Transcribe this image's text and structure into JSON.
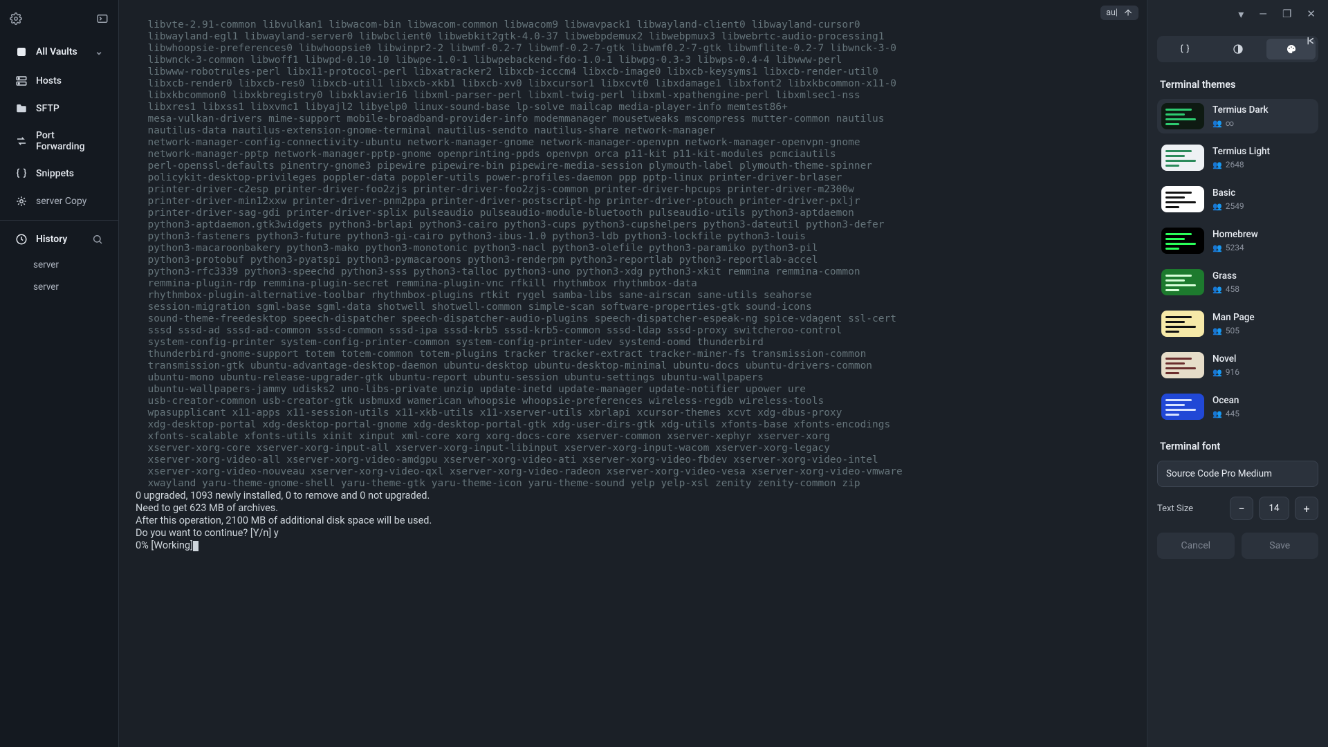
{
  "titlebar": {
    "dropdown": "▾",
    "minimize": "—",
    "maximize": "❐",
    "close": "✕"
  },
  "sidebar": {
    "vault_label": "All Vaults",
    "items": [
      {
        "icon": "hosts",
        "label": "Hosts"
      },
      {
        "icon": "sftp",
        "label": "SFTP"
      },
      {
        "icon": "portfwd",
        "label": "Port Forwarding"
      },
      {
        "icon": "snippets",
        "label": "Snippets"
      },
      {
        "icon": "servercopy",
        "label": "server Copy"
      }
    ],
    "history_label": "History",
    "history_items": [
      "server",
      "server"
    ]
  },
  "term_chip": {
    "text": "au|"
  },
  "terminal": {
    "dim_lines": [
      "  libvte-2.91-common libvulkan1 libwacom-bin libwacom-common libwacom9 libwavpack1 libwayland-client0 libwayland-cursor0",
      "  libwayland-egl1 libwayland-server0 libwbclient0 libwebkit2gtk-4.0-37 libwebpdemux2 libwebpmux3 libwebrtc-audio-processing1",
      "  libwhoopsie-preferences0 libwhoopsie0 libwinpr2-2 libwmf-0.2-7 libwmf-0.2-7-gtk libwmf0.2-7-gtk libwmflite-0.2-7 libwnck-3-0",
      "  libwnck-3-common libwoff1 libwpd-0.10-10 libwpe-1.0-1 libwpebackend-fdo-1.0-1 libwpg-0.3-3 libwps-0.4-4 libwww-perl",
      "  libwww-robotrules-perl libx11-protocol-perl libxatracker2 libxcb-icccm4 libxcb-image0 libxcb-keysyms1 libxcb-render-util0",
      "  libxcb-render0 libxcb-res0 libxcb-util1 libxcb-xkb1 libxcb-xv0 libxcursor1 libxcvt0 libxdamage1 libxfont2 libxkbcommon-x11-0",
      "  libxkbcommon0 libxkbregistry0 libxklavier16 libxml-parser-perl libxml-twig-perl libxml-xpathengine-perl libxmlsec1-nss",
      "  libxres1 libxss1 libxvmc1 libyajl2 libyelp0 linux-sound-base lp-solve mailcap media-player-info memtest86+",
      "  mesa-vulkan-drivers mime-support mobile-broadband-provider-info modemmanager mousetweaks mscompress mutter-common nautilus",
      "  nautilus-data nautilus-extension-gnome-terminal nautilus-sendto nautilus-share network-manager",
      "  network-manager-config-connectivity-ubuntu network-manager-gnome network-manager-openvpn network-manager-openvpn-gnome",
      "  network-manager-pptp network-manager-pptp-gnome openprinting-ppds openvpn orca p11-kit p11-kit-modules pcmciautils",
      "  perl-openssl-defaults pinentry-gnome3 pipewire pipewire-bin pipewire-media-session plymouth-label plymouth-theme-spinner",
      "  policykit-desktop-privileges poppler-data poppler-utils power-profiles-daemon ppp pptp-linux printer-driver-brlaser",
      "  printer-driver-c2esp printer-driver-foo2zjs printer-driver-foo2zjs-common printer-driver-hpcups printer-driver-m2300w",
      "  printer-driver-min12xxw printer-driver-pnm2ppa printer-driver-postscript-hp printer-driver-ptouch printer-driver-pxljr",
      "  printer-driver-sag-gdi printer-driver-splix pulseaudio pulseaudio-module-bluetooth pulseaudio-utils python3-aptdaemon",
      "  python3-aptdaemon.gtk3widgets python3-brlapi python3-cairo python3-cups python3-cupshelpers python3-dateutil python3-defer",
      "  python3-fasteners python3-future python3-gi-cairo python3-ibus-1.0 python3-ldb python3-lockfile python3-louis",
      "  python3-macaroonbakery python3-mako python3-monotonic python3-nacl python3-olefile python3-paramiko python3-pil",
      "  python3-protobuf python3-pyatspi python3-pymacaroons python3-renderpm python3-reportlab python3-reportlab-accel",
      "  python3-rfc3339 python3-speechd python3-sss python3-talloc python3-uno python3-xdg python3-xkit remmina remmina-common",
      "  remmina-plugin-rdp remmina-plugin-secret remmina-plugin-vnc rfkill rhythmbox rhythmbox-data",
      "  rhythmbox-plugin-alternative-toolbar rhythmbox-plugins rtkit rygel samba-libs sane-airscan sane-utils seahorse",
      "  session-migration sgml-base sgml-data shotwell shotwell-common simple-scan software-properties-gtk sound-icons",
      "  sound-theme-freedesktop speech-dispatcher speech-dispatcher-audio-plugins speech-dispatcher-espeak-ng spice-vdagent ssl-cert",
      "  sssd sssd-ad sssd-ad-common sssd-common sssd-ipa sssd-krb5 sssd-krb5-common sssd-ldap sssd-proxy switcheroo-control",
      "  system-config-printer system-config-printer-common system-config-printer-udev systemd-oomd thunderbird",
      "  thunderbird-gnome-support totem totem-common totem-plugins tracker tracker-extract tracker-miner-fs transmission-common",
      "  transmission-gtk ubuntu-advantage-desktop-daemon ubuntu-desktop ubuntu-desktop-minimal ubuntu-docs ubuntu-drivers-common",
      "  ubuntu-mono ubuntu-release-upgrader-gtk ubuntu-report ubuntu-session ubuntu-settings ubuntu-wallpapers",
      "  ubuntu-wallpapers-jammy udisks2 uno-libs-private unzip update-inetd update-manager update-notifier upower ure",
      "  usb-creator-common usb-creator-gtk usbmuxd wamerican whoopsie whoopsie-preferences wireless-regdb wireless-tools",
      "  wpasupplicant x11-apps x11-session-utils x11-xkb-utils x11-xserver-utils xbrlapi xcursor-themes xcvt xdg-dbus-proxy",
      "  xdg-desktop-portal xdg-desktop-portal-gnome xdg-desktop-portal-gtk xdg-user-dirs-gtk xdg-utils xfonts-base xfonts-encodings",
      "  xfonts-scalable xfonts-utils xinit xinput xml-core xorg xorg-docs-core xserver-common xserver-xephyr xserver-xorg",
      "  xserver-xorg-core xserver-xorg-input-all xserver-xorg-input-libinput xserver-xorg-input-wacom xserver-xorg-legacy",
      "  xserver-xorg-video-all xserver-xorg-video-amdgpu xserver-xorg-video-ati xserver-xorg-video-fbdev xserver-xorg-video-intel",
      "  xserver-xorg-video-nouveau xserver-xorg-video-qxl xserver-xorg-video-radeon xserver-xorg-video-vesa xserver-xorg-video-vmware",
      "  xwayland yaru-theme-gnome-shell yaru-theme-gtk yaru-theme-icon yaru-theme-sound yelp yelp-xsl zenity zenity-common zip"
    ],
    "tail_lines": [
      "0 upgraded, 1093 newly installed, 0 to remove and 0 not upgraded.",
      "Need to get 623 MB of archives.",
      "After this operation, 2100 MB of additional disk space will be used.",
      "Do you want to continue? [Y/n] y",
      "0% [Working]"
    ]
  },
  "panel": {
    "themes_heading": "Terminal themes",
    "themes": [
      {
        "name": "Termius Dark",
        "users": "∞",
        "bg": "#0e1a12",
        "accent": "#2ecc71",
        "sel": true
      },
      {
        "name": "Termius Light",
        "users": "2648",
        "bg": "#eef1f4",
        "accent": "#2b8a5b"
      },
      {
        "name": "Basic",
        "users": "2549",
        "bg": "#ffffff",
        "accent": "#111111"
      },
      {
        "name": "Homebrew",
        "users": "5234",
        "bg": "#000000",
        "accent": "#2bff5a"
      },
      {
        "name": "Grass",
        "users": "458",
        "bg": "#1d7a2e",
        "accent": "#d8ffda"
      },
      {
        "name": "Man Page",
        "users": "505",
        "bg": "#f6e9a8",
        "accent": "#111111"
      },
      {
        "name": "Novel",
        "users": "916",
        "bg": "#e6ddc9",
        "accent": "#6b2e2e"
      },
      {
        "name": "Ocean",
        "users": "445",
        "bg": "#2148d6",
        "accent": "#d7e3ff"
      }
    ],
    "font_heading": "Terminal font",
    "font_value": "Source Code Pro Medium",
    "size_label": "Text Size",
    "size_value": "14",
    "cancel": "Cancel",
    "save": "Save"
  }
}
